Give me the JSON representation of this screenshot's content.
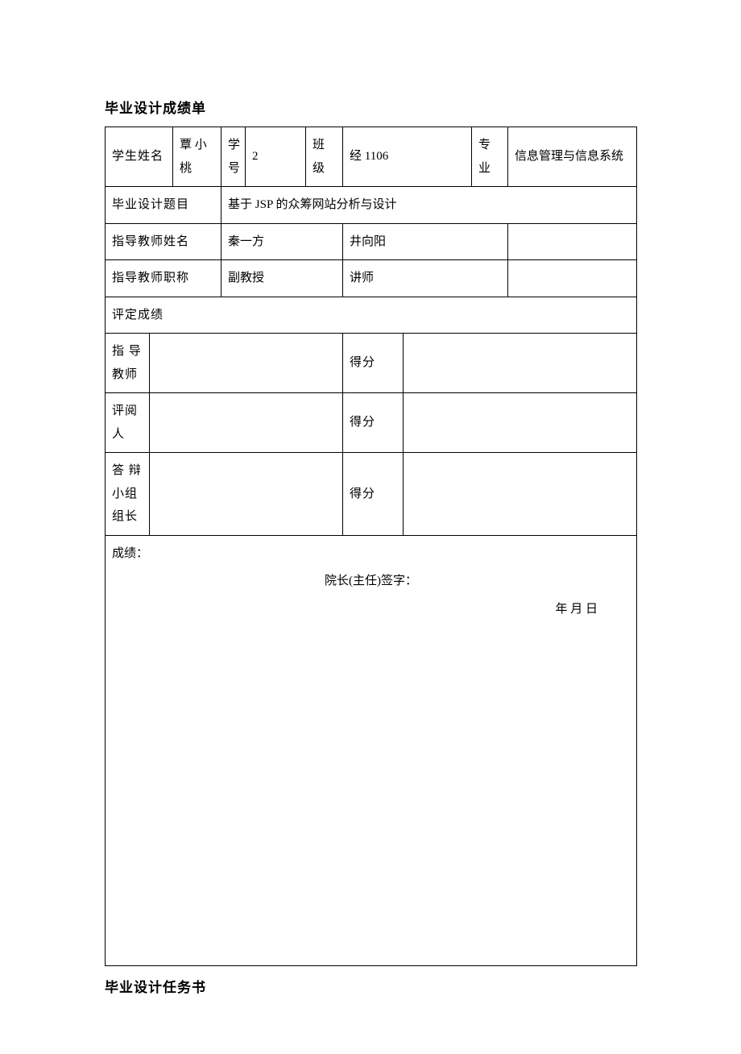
{
  "title_top": "毕业设计成绩单",
  "row1": {
    "l_name": "学生姓名",
    "v_name": "覃 小桃",
    "l_id": "学号",
    "v_id": "2",
    "l_class": "班级",
    "v_class": "经 1106",
    "l_major": "专业",
    "v_major": "信息管理与信息系统"
  },
  "row2": {
    "l_topic": "毕业设计题目",
    "v_topic": "基于 JSP 的众筹网站分析与设计"
  },
  "row3": {
    "l_advname": "指导教师姓名",
    "v_adv1": "秦一方",
    "v_adv2": "井向阳"
  },
  "row4": {
    "l_advtitle": "指导教师职称",
    "v_t1": "副教授",
    "v_t2": "讲师"
  },
  "row5": {
    "l_eval": "评定成绩"
  },
  "score_rows": {
    "r1l": "指 导教师",
    "r2l": "评阅人",
    "r3l": "答 辩 小组组长",
    "score": "得分"
  },
  "sign": {
    "line1": "成绩：",
    "line2": "院长(主任)签字：",
    "line3": "年 月 日"
  },
  "title_bottom": "毕业设计任务书"
}
